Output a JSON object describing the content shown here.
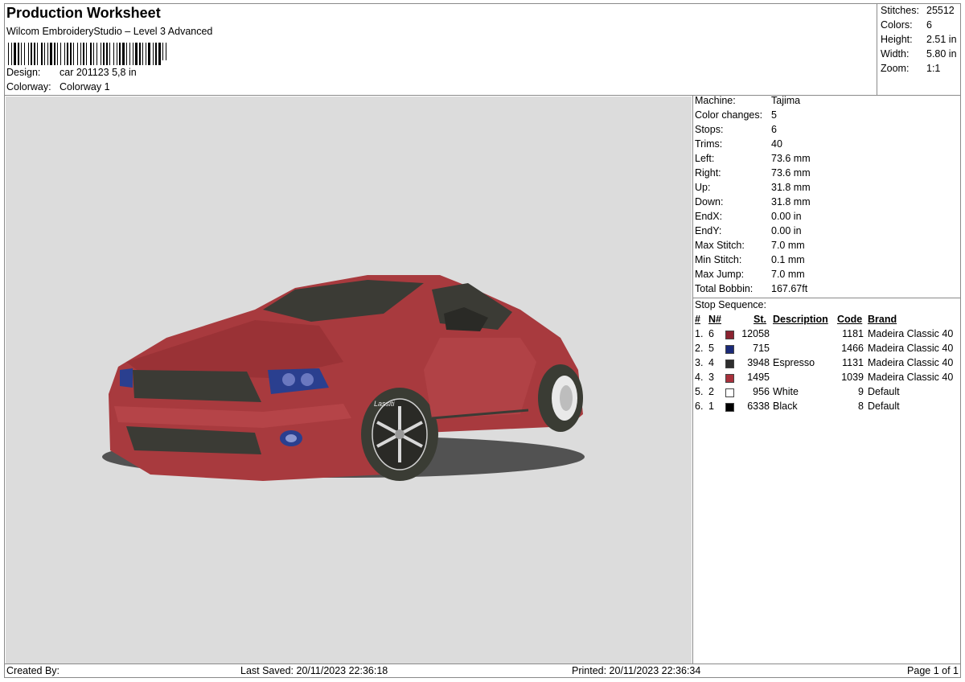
{
  "header": {
    "title": "Production Worksheet",
    "subtitle": "Wilcom EmbroideryStudio – Level 3 Advanced",
    "design_label": "Design:",
    "design_value": "car 201123 5,8 in",
    "colorway_label": "Colorway:",
    "colorway_value": "Colorway 1"
  },
  "summary": {
    "stitches_label": "Stitches:",
    "stitches_value": "25512",
    "colors_label": "Colors:",
    "colors_value": "6",
    "height_label": "Height:",
    "height_value": "2.51 in",
    "width_label": "Width:",
    "width_value": "5.80 in",
    "zoom_label": "Zoom:",
    "zoom_value": "1:1"
  },
  "details": [
    {
      "label": "Machine:",
      "value": "Tajima"
    },
    {
      "label": "Color changes:",
      "value": "5"
    },
    {
      "label": "Stops:",
      "value": "6"
    },
    {
      "label": "Trims:",
      "value": "40"
    },
    {
      "label": "Left:",
      "value": "73.6 mm"
    },
    {
      "label": "Right:",
      "value": "73.6 mm"
    },
    {
      "label": "Up:",
      "value": "31.8 mm"
    },
    {
      "label": "Down:",
      "value": "31.8 mm"
    },
    {
      "label": "EndX:",
      "value": "0.00 in"
    },
    {
      "label": "EndY:",
      "value": "0.00 in"
    },
    {
      "label": "Max Stitch:",
      "value": "7.0 mm"
    },
    {
      "label": "Min Stitch:",
      "value": "0.1 mm"
    },
    {
      "label": "Max Jump:",
      "value": "7.0 mm"
    },
    {
      "label": "Total Bobbin:",
      "value": "167.67ft"
    }
  ],
  "stop_sequence": {
    "title": "Stop Sequence:",
    "headers": {
      "num": "#",
      "n": "N#",
      "st": "St.",
      "description": "Description",
      "code": "Code",
      "brand": "Brand"
    },
    "rows": [
      {
        "num": "1.",
        "n": "6",
        "color": "#8b2330",
        "st": "12058",
        "description": "",
        "code": "1181",
        "brand": "Madeira Classic 40"
      },
      {
        "num": "2.",
        "n": "5",
        "color": "#1a2a78",
        "st": "715",
        "description": "",
        "code": "1466",
        "brand": "Madeira Classic 40"
      },
      {
        "num": "3.",
        "n": "4",
        "color": "#2e2e2e",
        "st": "3948",
        "description": "Espresso",
        "code": "1131",
        "brand": "Madeira Classic 40"
      },
      {
        "num": "4.",
        "n": "3",
        "color": "#a8303b",
        "st": "1495",
        "description": "",
        "code": "1039",
        "brand": "Madeira Classic 40"
      },
      {
        "num": "5.",
        "n": "2",
        "color": "#ffffff",
        "st": "956",
        "description": "White",
        "code": "9",
        "brand": "Default"
      },
      {
        "num": "6.",
        "n": "1",
        "color": "#000000",
        "st": "6338",
        "description": "Black",
        "code": "8",
        "brand": "Default"
      }
    ]
  },
  "preview": {
    "background": "#dcdcdc",
    "body_color": "#a83a3e",
    "wheel_text": "Lassiti"
  },
  "footer": {
    "created_by": "Created By:",
    "last_saved": "Last Saved: 20/11/2023 22:36:18",
    "printed": "Printed: 20/11/2023 22:36:34",
    "page": "Page 1 of 1"
  }
}
